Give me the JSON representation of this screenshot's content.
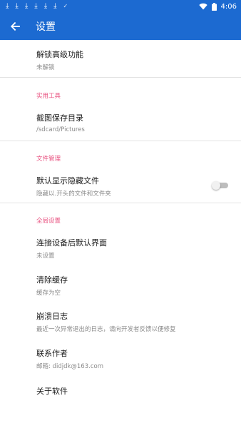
{
  "status_bar": {
    "notification_icons": [
      "download-icon",
      "download-icon",
      "download-icon",
      "download-icon",
      "download-icon",
      "download-icon",
      "check-icon"
    ],
    "time": "4:06"
  },
  "app_bar": {
    "title": "设置",
    "color": "#1c6ad1"
  },
  "settings": {
    "unlock": {
      "title": "解锁高级功能",
      "subtitle": "未解锁"
    },
    "tools_section": "实用工具",
    "screenshot_dir": {
      "title": "截图保存目录",
      "subtitle": "/sdcard/Pictures"
    },
    "file_section": "文件管理",
    "show_hidden": {
      "title": "默认显示隐藏文件",
      "subtitle": "隐藏以.开头的文件和文件夹",
      "enabled": false
    },
    "global_section": "全局设置",
    "default_screen": {
      "title": "连接设备后默认界面",
      "subtitle": "未设置"
    },
    "clear_cache": {
      "title": "清除缓存",
      "subtitle": "缓存为空"
    },
    "crash_log": {
      "title": "崩溃日志",
      "subtitle": "最近一次异常退出的日志，请向开发者反馈以便修复"
    },
    "contact": {
      "title": "联系作者",
      "subtitle": "邮箱: didjdk@163.com"
    },
    "about": {
      "title": "关于软件"
    }
  },
  "colors": {
    "accent_pink": "#e8507f",
    "primary_blue": "#1c6ad1"
  }
}
